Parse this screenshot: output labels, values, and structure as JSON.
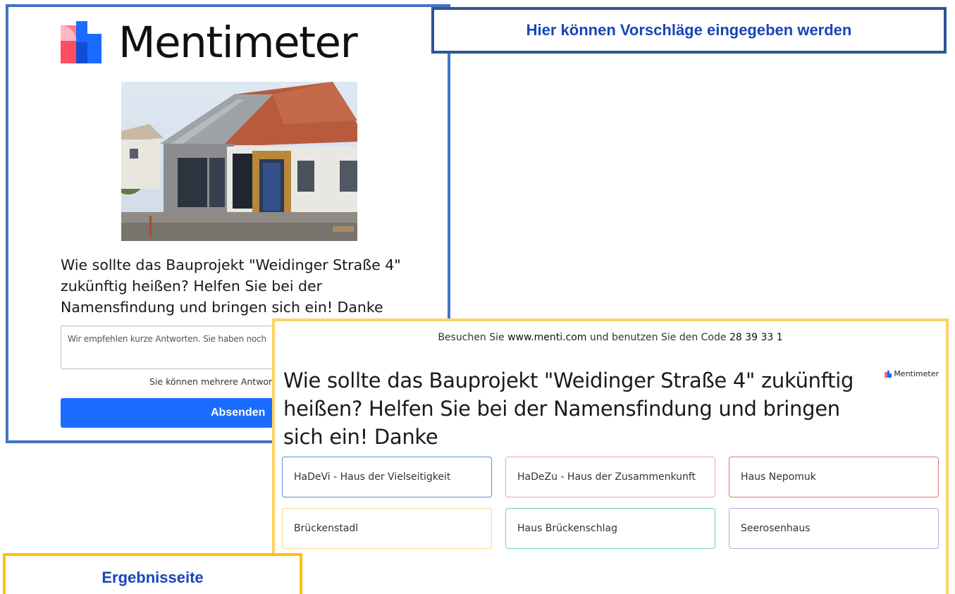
{
  "brand": {
    "name": "Mentimeter",
    "logo_icon": "mentimeter-logo-icon"
  },
  "vote_page": {
    "question": "Wie sollte das Bauprojekt \"Weidinger Straße 4\" zukünftig heißen? Helfen Sie bei der Namensfindung und bringen sich ein! Danke",
    "input_placeholder": "Wir empfehlen kurze Antworten. Sie haben noch",
    "multi_note": "Sie können mehrere Antwort",
    "submit_label": "Absenden"
  },
  "callouts": {
    "top": "Hier können Vorschläge eingegeben werden",
    "bottom": "Ergebnisseite"
  },
  "results": {
    "visit_prefix": "Besuchen Sie",
    "visit_url": "www.menti.com",
    "visit_middle": "und benutzen Sie den Code",
    "code": "28 39 33 1",
    "badge": "Mentimeter",
    "question": "Wie sollte das Bauprojekt \"Weidinger Straße 4\" zukünftig heißen? Helfen Sie bei der Namensfindung und bringen sich ein! Danke",
    "answers": [
      {
        "label": "HaDeVi - Haus der Vielseitigkeit",
        "color": "#5b8dd9"
      },
      {
        "label": "HaDeZu - Haus der Zusammenkunft",
        "color": "#f0a3a8"
      },
      {
        "label": "Haus Nepomuk",
        "color": "#e57373"
      },
      {
        "label": "Brückenstadl",
        "color": "#f7d98f"
      },
      {
        "label": "Haus Brückenschlag",
        "color": "#6fd1b0"
      },
      {
        "label": "Seerosenhaus",
        "color": "#b7a8e0"
      }
    ]
  },
  "colors": {
    "submit_blue": "#196cff",
    "vote_frame": "#4472c4",
    "results_frame": "#fcd466",
    "callout_text": "#1a44b8"
  }
}
